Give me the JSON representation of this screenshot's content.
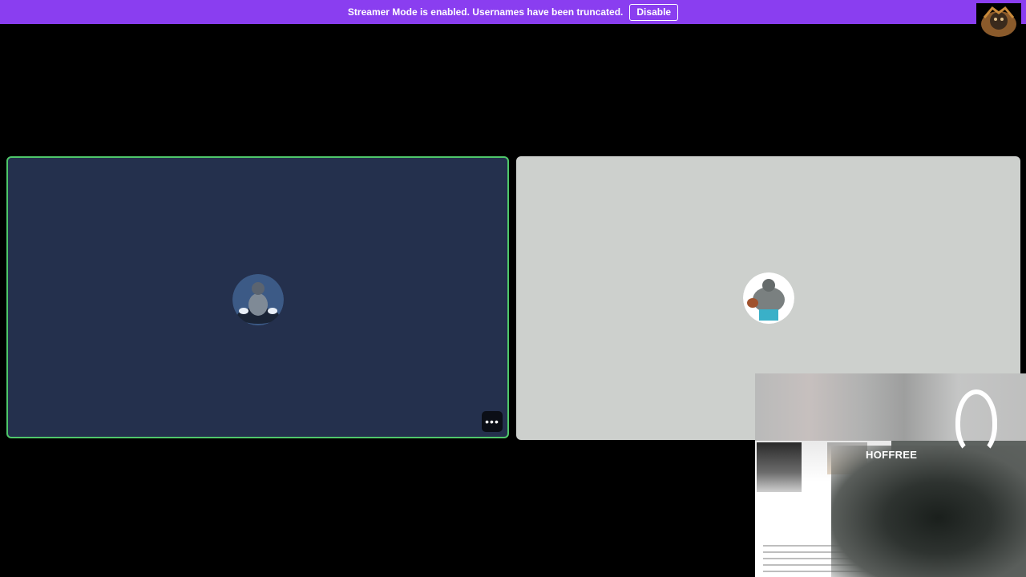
{
  "banner": {
    "message": "Streamer Mode is enabled. Usernames have been truncated.",
    "disable_label": "Disable",
    "color": "#8a3ef0"
  },
  "corner_avatar": {
    "icon": "user-avatar-icon"
  },
  "tiles": [
    {
      "background": "#24304d",
      "speaking": true,
      "speaking_color": "#4fc76a",
      "more_label": "•••"
    },
    {
      "background": "#cdd0cd",
      "speaking": false
    }
  ],
  "webcam": {
    "overlay_text": "HOFFREE"
  }
}
